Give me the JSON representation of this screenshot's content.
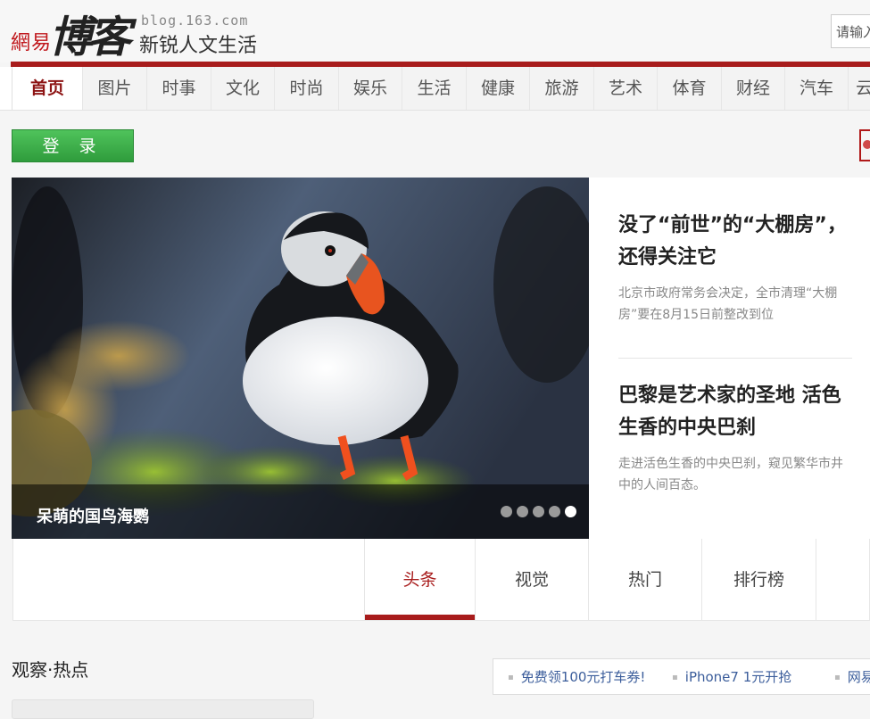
{
  "header": {
    "logo_wy": "網易",
    "logo_bk": "博客",
    "url": "blog.163.com",
    "slogan": "新锐人文生活",
    "search_placeholder": "请输入"
  },
  "nav": {
    "items": [
      "首页",
      "图片",
      "时事",
      "文化",
      "时尚",
      "娱乐",
      "生活",
      "健康",
      "旅游",
      "艺术",
      "体育",
      "财经",
      "汽车",
      "云"
    ]
  },
  "login": {
    "label": "登 录"
  },
  "slider": {
    "caption": "呆萌的国鸟海鹦",
    "image_alt": "海鹦"
  },
  "side_news": [
    {
      "title": "没了“前世”的“大棚房”，还得关注它",
      "desc": "北京市政府常务会决定，全市清理“大棚房”要在8月15日前整改到位"
    },
    {
      "title": "巴黎是艺术家的圣地 活色生香的中央巴刹",
      "desc": "走进活色生香的中央巴刹，窥见繁华市井中的人间百态。"
    }
  ],
  "tabs": [
    "头条",
    "视觉",
    "热门",
    "排行榜"
  ],
  "section": {
    "title": "观察·热点"
  },
  "ads": [
    "免费领100元打车券!",
    "iPhone7 1元开抢",
    "网易"
  ],
  "colors": {
    "brand_red": "#a81c1c",
    "login_green": "#3aae47"
  }
}
